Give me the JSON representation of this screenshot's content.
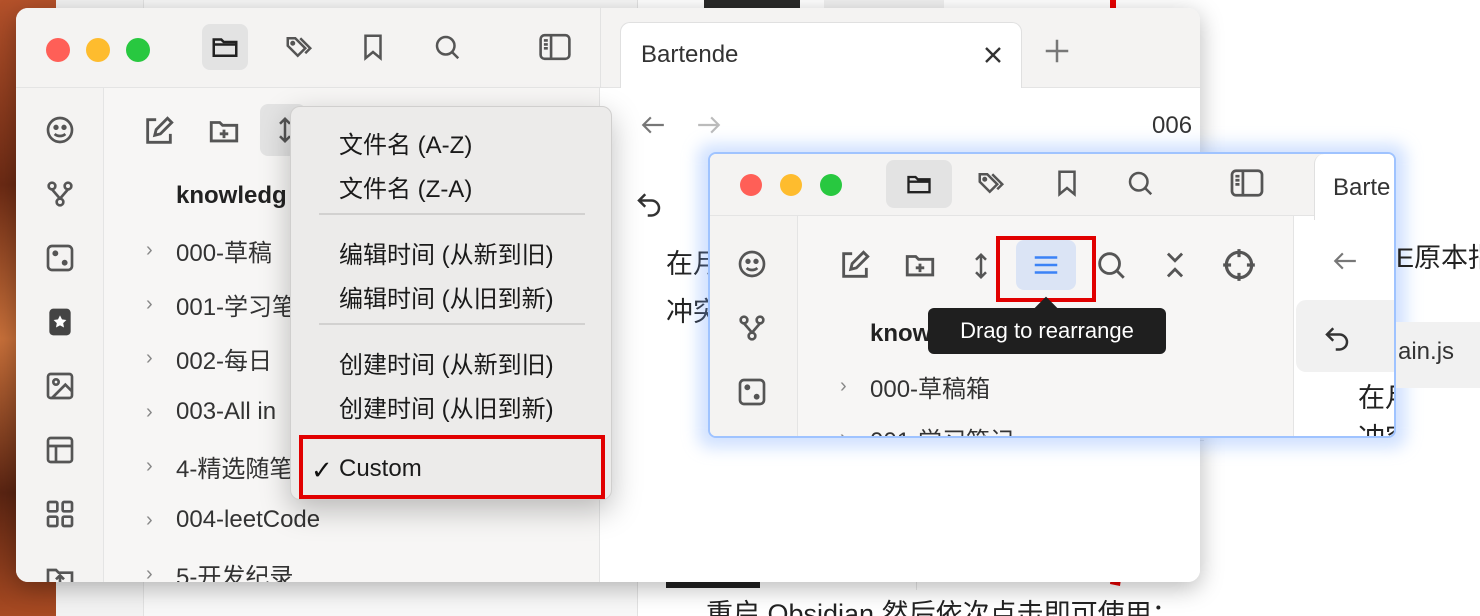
{
  "background": {
    "bottom_text": "重启 Obsidian 然后依次点击即可使用："
  },
  "main_window": {
    "tab_title": "Bartende",
    "note_number": "006",
    "note_text_lines": [
      "在月",
      "冲突"
    ],
    "vault_name": "knowledg",
    "files": [
      {
        "label": "000-草稿"
      },
      {
        "label": "001-学习笔"
      },
      {
        "label": "002-每日"
      },
      {
        "label": "003-All in"
      },
      {
        "label": "4-精选随笔"
      },
      {
        "label": "004-leetCode"
      },
      {
        "label": "5-开发纪录"
      }
    ],
    "sort_menu": {
      "group1": [
        "文件名 (A-Z)",
        "文件名 (Z-A)"
      ],
      "group2": [
        "编辑时间 (从新到旧)",
        "编辑时间 (从旧到新)"
      ],
      "group3": [
        "创建时间 (从新到旧)",
        "创建时间 (从旧到新)"
      ],
      "checked_item": "Custom",
      "check_mark": "✓"
    }
  },
  "small_window": {
    "tab_title": "Barte",
    "vault_name": "knowl",
    "files": [
      {
        "label": "000-草稿箱"
      },
      {
        "label": "001-学习笔记"
      }
    ],
    "tooltip": "Drag to rearrange",
    "right_text_1": "E原本指",
    "right_text_2": "ain.js",
    "right_text_3": "在月",
    "right_text_4": "冲突"
  },
  "colors": {
    "highlight_red": "#e10000",
    "traffic_red": "#ff5f57",
    "traffic_yellow": "#febc2e",
    "traffic_green": "#28c840",
    "accent_blue": "#3b82f6"
  }
}
